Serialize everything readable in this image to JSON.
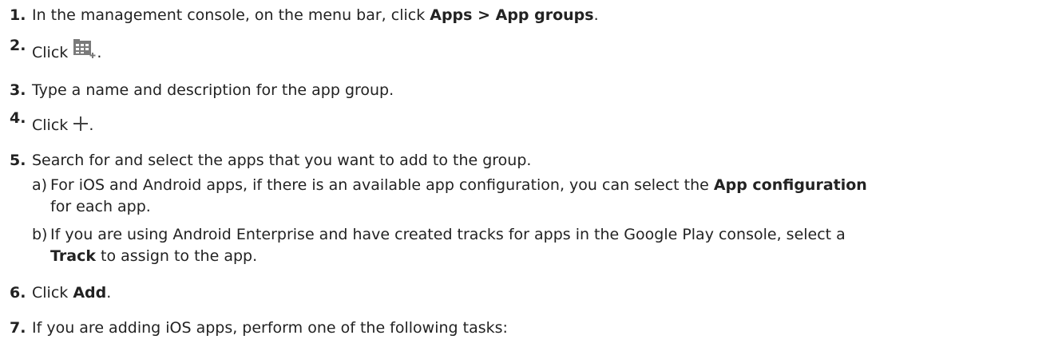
{
  "steps": [
    {
      "num": "1.",
      "pre": "In the management console, on the menu bar, click ",
      "bold": "Apps > App groups",
      "post": "."
    },
    {
      "num": "2.",
      "pre": "Click ",
      "icon": "app-group-add-icon",
      "post": "."
    },
    {
      "num": "3.",
      "text": "Type a name and description for the app group."
    },
    {
      "num": "4.",
      "pre": "Click ",
      "icon": "plus-icon",
      "post": "."
    },
    {
      "num": "5.",
      "text": "Search for and select the apps that you want to add to the group.",
      "substeps": [
        {
          "letter": "a)",
          "pre": "For iOS and Android apps, if there is an available app configuration, you can select the ",
          "bold": "App configuration",
          "cont": "for each app."
        },
        {
          "letter": "b)",
          "pre": "If you are using Android Enterprise and have created tracks for apps in the Google Play console, select a",
          "bold": "Track",
          "post": " to assign to the app."
        }
      ]
    },
    {
      "num": "6.",
      "pre": "Click ",
      "bold": "Add",
      "post": "."
    },
    {
      "num": "7.",
      "text": "If you are adding iOS apps, perform one of the following tasks:"
    }
  ],
  "colors": {
    "text": "#222222",
    "icon_gray": "#7a7a7a"
  }
}
